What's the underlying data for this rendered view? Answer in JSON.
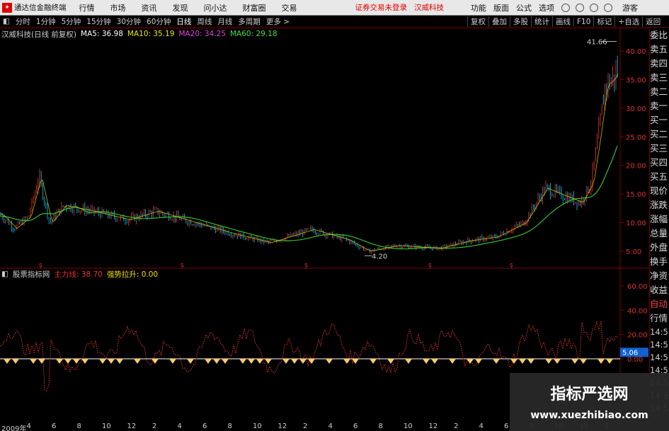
{
  "menubar": {
    "app_title": "通达信金融终端",
    "items": [
      "行情",
      "市场",
      "资讯",
      "发现",
      "问小达",
      "财富圈",
      "交易"
    ],
    "status": "证券交易未登录",
    "stock": "汉威科技",
    "right": [
      "功能",
      "版面",
      "公式",
      "选项"
    ],
    "user": "游客"
  },
  "tabs": [
    "分时",
    "1分钟",
    "5分钟",
    "15分钟",
    "30分钟",
    "60分钟",
    "日线",
    "周线",
    "月线",
    "多周期",
    "更多 >"
  ],
  "active_tab": "日线",
  "tools": [
    "复权",
    "叠加",
    "多股",
    "统计",
    "画线",
    "F10",
    "标记",
    "+自选",
    "返回"
  ],
  "main_info": {
    "title": "汉威科技(日线 前复权)",
    "ma": [
      {
        "label": "MA5: 36.98",
        "color": "#ffffff"
      },
      {
        "label": "MA10: 35.19",
        "color": "#e8e800"
      },
      {
        "label": "MA20: 34.25",
        "color": "#e040e0"
      },
      {
        "label": "MA60: 29.18",
        "color": "#40e040"
      }
    ]
  },
  "price_high": "41.66",
  "price_low": "4.20",
  "price_axis": [
    "40.00",
    "35.00",
    "30.00",
    "25.00",
    "20.00",
    "15.00",
    "10.00",
    "5.00"
  ],
  "sub_info": {
    "title": "股票指标网",
    "main": "主力线: 38.70",
    "pull": "强势拉升: 0.00"
  },
  "sub_axis": [
    "60.00",
    "40.00",
    "20.00",
    "0.00"
  ],
  "sub_current": "5.06",
  "side_panel": [
    "委比",
    "卖五",
    "卖四",
    "卖三",
    "卖二",
    "卖一",
    "买一",
    "买二",
    "买三",
    "买四",
    "买五",
    "现价",
    "涨跌",
    "涨幅",
    "总量",
    "外盘",
    "换手",
    "净资",
    "收益"
  ],
  "side_bottom_title": "自动",
  "side_bottom_sub": "行情",
  "side_times": [
    "14:5",
    "14:5",
    "14:5",
    "14:5",
    "14:5",
    "14:5",
    "14:5"
  ],
  "x_axis": [
    "2009年",
    "4",
    "6",
    "8",
    "10",
    "12",
    "2",
    "4",
    "6",
    "8",
    "10",
    "12",
    "2",
    "4",
    "6",
    "8",
    "10",
    "12",
    "2",
    "4",
    "6",
    "8",
    "10",
    "12",
    "2"
  ],
  "watermark": {
    "title": "指标严选网",
    "url": "www.xuezhibiao.com"
  },
  "colors": {
    "up": "#ff3232",
    "down": "#00c8ff",
    "ma60": "#30c030",
    "axis": "#800000",
    "zero": "#ffffff",
    "diamond": "#ffcc66"
  }
}
